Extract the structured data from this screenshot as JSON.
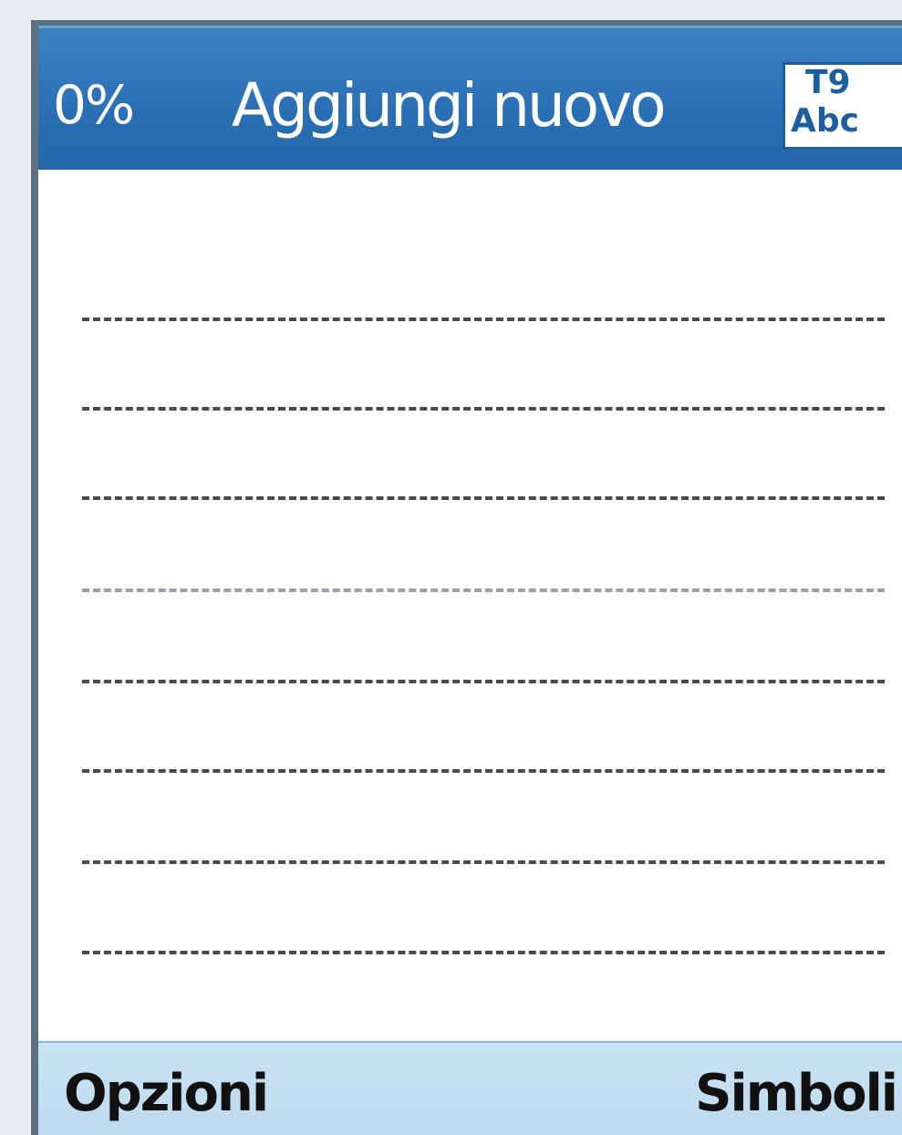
{
  "header": {
    "memory_percent": "0%",
    "title": "Aggiungi nuovo",
    "input_mode": {
      "line1": "T9",
      "line2": "Abc"
    }
  },
  "softkeys": {
    "left": "Opzioni",
    "right": "Simboli"
  },
  "editor": {
    "line_count": 8,
    "text": ""
  },
  "colors": {
    "title_bar": "#2a6fb4",
    "softkey_bar": "#c4dff1",
    "frame": "#5d7180"
  }
}
